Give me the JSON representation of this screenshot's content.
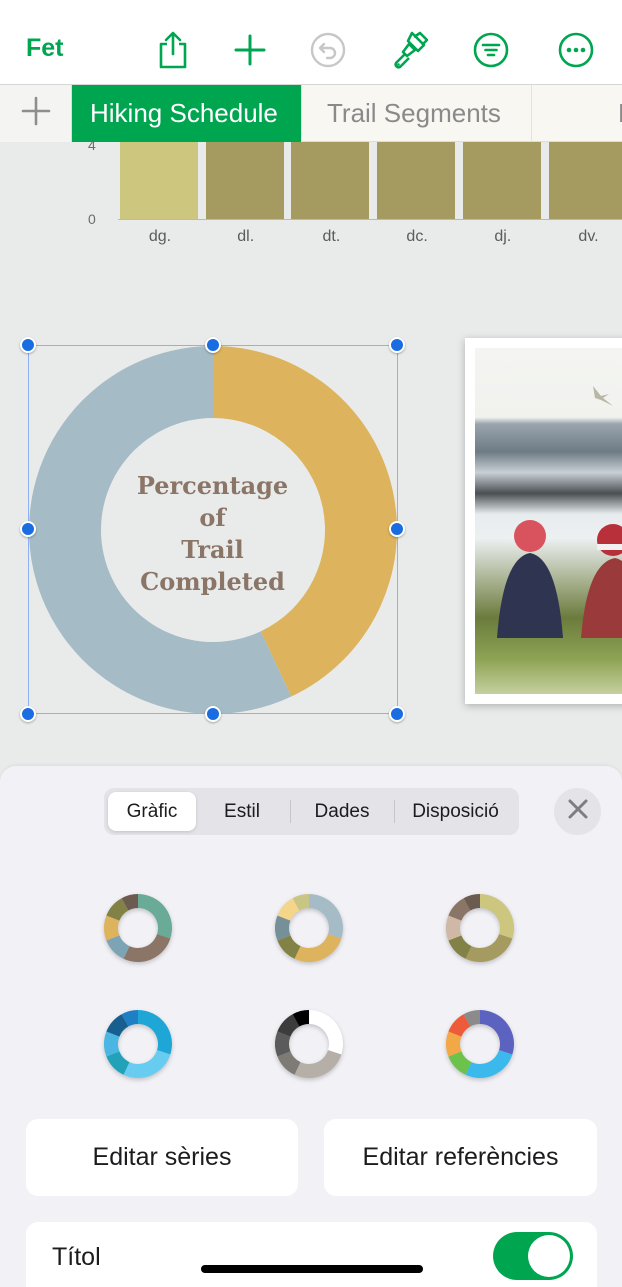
{
  "toolbar": {
    "done_label": "Fet",
    "icons": [
      "share-icon",
      "add-icon",
      "undo-icon",
      "format-brush-icon",
      "organize-icon",
      "more-icon"
    ],
    "accent_color": "#00a550",
    "undo_enabled": false
  },
  "sheet_tabs": {
    "add_icon": "plus-icon",
    "tabs": [
      {
        "label": "Hiking Schedule",
        "active": true
      },
      {
        "label": "Trail Segments",
        "active": false
      },
      {
        "label": "E",
        "active": false
      }
    ]
  },
  "chart_data": [
    {
      "type": "bar",
      "title": "",
      "categories": [
        "dg.",
        "dl.",
        "dt.",
        "dc.",
        "dj.",
        "dv."
      ],
      "values": [
        4,
        4,
        4,
        4,
        4,
        4
      ],
      "note": "bars extend beyond the visible top of the chart (clipped above 4)",
      "yticks": [
        "0",
        "4"
      ],
      "ylim": [
        0,
        4
      ],
      "colors": [
        "#cdc67e",
        "#a59a5f",
        "#a59a5f",
        "#a59a5f",
        "#a59a5f",
        "#a59a5f"
      ]
    },
    {
      "type": "pie",
      "subtype": "donut",
      "title": "Percentage of Trail Completed",
      "title_lines": [
        "Percentage",
        "of",
        "Trail",
        "Completed"
      ],
      "slices": [
        {
          "value": 43,
          "color": "#ddb35e"
        },
        {
          "value": 57,
          "color": "#a5bcc6"
        }
      ]
    }
  ],
  "panel": {
    "segments": [
      {
        "label": "Gràfic",
        "active": true
      },
      {
        "label": "Estil",
        "active": false
      },
      {
        "label": "Dades",
        "active": false
      },
      {
        "label": "Disposició",
        "active": false
      }
    ],
    "close_icon": "close-icon",
    "style_options": [
      {
        "name": "style-earthy",
        "colors": [
          "#6aab98",
          "#8a7567",
          "#7ca4b4",
          "#ddb35e",
          "#838246",
          "#6b5b50"
        ]
      },
      {
        "name": "style-dusty",
        "colors": [
          "#a5bcc6",
          "#ddb35e",
          "#838246",
          "#76909a",
          "#f5d58a",
          "#c9c584"
        ]
      },
      {
        "name": "style-olive",
        "colors": [
          "#cdc67e",
          "#a59a5f",
          "#838246",
          "#cfb8a5",
          "#8a7567",
          "#6b5b50"
        ]
      },
      {
        "name": "style-blue",
        "colors": [
          "#1ea7d6",
          "#68ccf1",
          "#22a2b9",
          "#4cb6e2",
          "#165f8f",
          "#1f7fc4"
        ]
      },
      {
        "name": "style-gray",
        "colors": [
          "#ffffff",
          "#b6afa7",
          "#7e7a76",
          "#5b5b5b",
          "#3c3c3c",
          "#000000"
        ]
      },
      {
        "name": "style-vivid",
        "colors": [
          "#5c62c0",
          "#3bb8ec",
          "#6cc24a",
          "#f3a847",
          "#ee5b3b",
          "#8b8b8b"
        ]
      }
    ],
    "edit_series_label": "Editar sèries",
    "edit_references_label": "Editar referències",
    "title_row": {
      "label": "Títol",
      "enabled": true
    }
  }
}
